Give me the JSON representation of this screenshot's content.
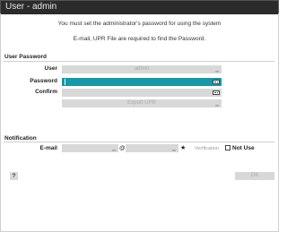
{
  "window": {
    "title": "User - admin"
  },
  "messages": {
    "line1": "You must set the administrator's password for using the system",
    "line2": "E-mail, UPR File are required to find the Password."
  },
  "user_password": {
    "section_title": "User Password",
    "user_label": "User",
    "user_value": "admin",
    "password_label": "Password",
    "confirm_label": "Confirm",
    "export_label": "Export UPR"
  },
  "notification": {
    "section_title": "Notification",
    "email_label": "E-mail",
    "at_sign": "@",
    "verification_label": "Verification",
    "not_use_label": "Not Use"
  },
  "footer": {
    "help_label": "?",
    "ok_label": "OK"
  }
}
